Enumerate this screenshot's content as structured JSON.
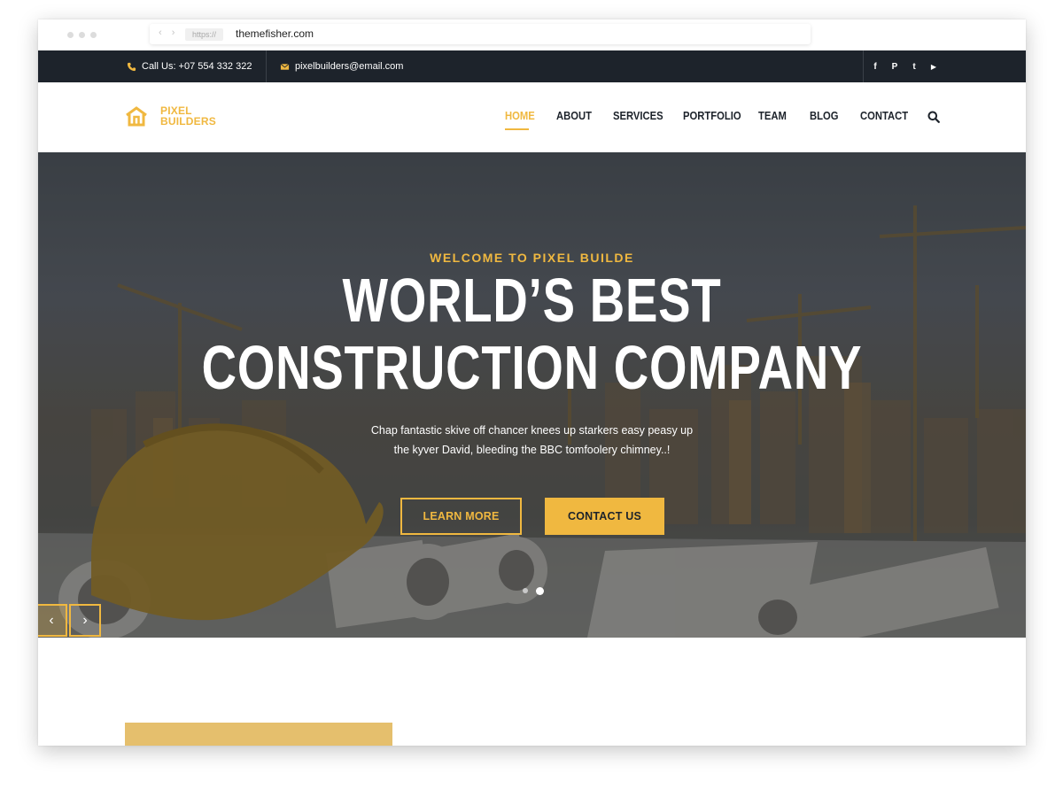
{
  "browser": {
    "nav_arrows": "‹ ›",
    "protocol": "https://",
    "url": "themefisher.com"
  },
  "topbar": {
    "phone": "Call Us: +07 554 332 322",
    "email": "pixelbuilders@email.com",
    "social": [
      {
        "name": "facebook-icon",
        "glyph": "f"
      },
      {
        "name": "pinterest-icon",
        "glyph": "P"
      },
      {
        "name": "twitter-icon",
        "glyph": "t"
      },
      {
        "name": "youtube-icon",
        "glyph": "▶"
      }
    ]
  },
  "logo": {
    "line1": "PIXEL",
    "line2": "BUILDERS"
  },
  "nav": {
    "items": [
      "HOME",
      "ABOUT",
      "SERVICES",
      "PORTFOLIO",
      "TEAM",
      "BLOG",
      "CONTACT"
    ],
    "active": "HOME"
  },
  "hero": {
    "eyebrow": "WELCOME TO PIXEL BUILDE",
    "headline_line1": "WORLD’S BEST",
    "headline_line2": "CONSTRUCTION COMPANY",
    "subtext_line1": "Chap fantastic skive off chancer knees up starkers easy peasy up",
    "subtext_line2": "the kyver David, bleeding the BBC tomfoolery chimney..!",
    "primary_button": "LEARN MORE",
    "secondary_button": "CONTACT US",
    "slide_count": 2,
    "active_slide": 2,
    "prev_arrow": "‹",
    "next_arrow": "›"
  },
  "colors": {
    "accent": "#f0b840",
    "dark": "#1d232b"
  }
}
